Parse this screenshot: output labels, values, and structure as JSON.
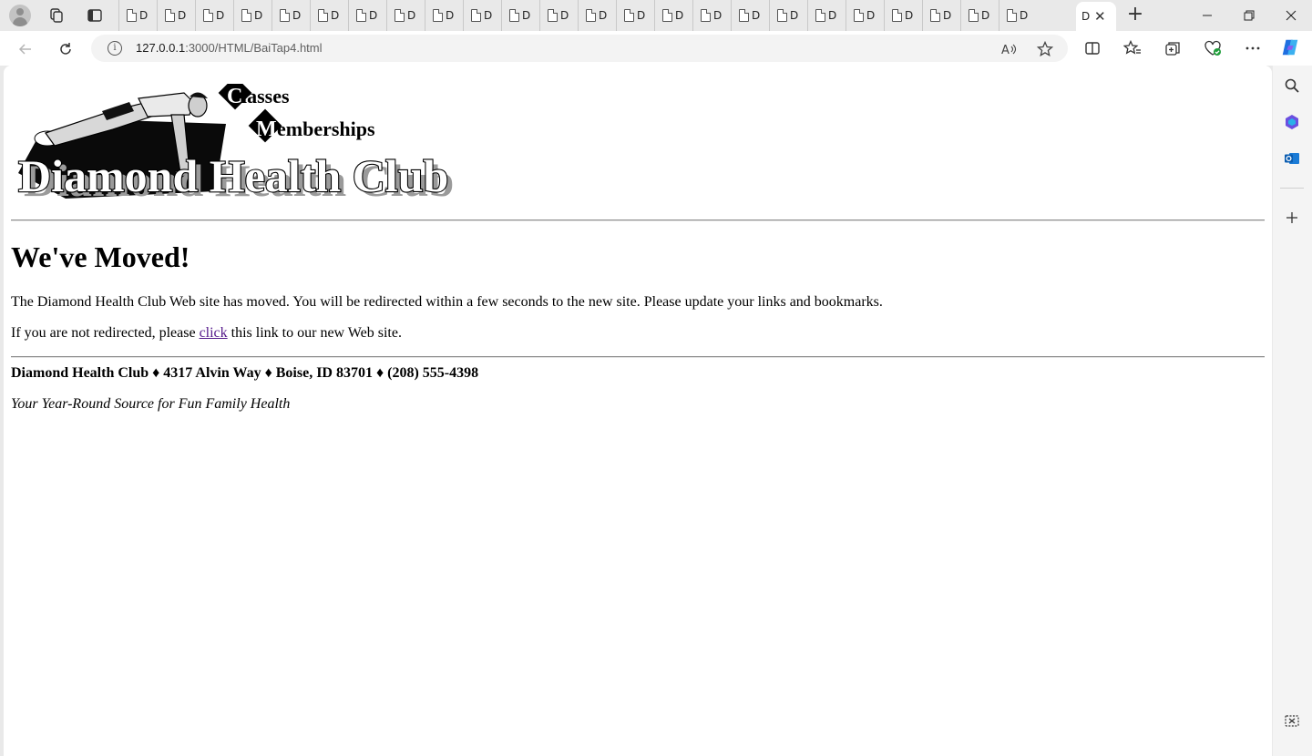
{
  "browser": {
    "tab_title_short": "D",
    "mini_tab_count": 24,
    "url_host": "127.0.0.1",
    "url_rest": ":3000/HTML/BaiTap4.html"
  },
  "banner": {
    "line1": "Classes",
    "line2": "Memberships",
    "title": "Diamond Health Club"
  },
  "page": {
    "heading": "We've Moved!",
    "paragraph1": "The Diamond Health Club Web site has moved. You will be redirected within a few seconds to the new site. Please update your links and bookmarks.",
    "p2_before": "If you are not redirected, please ",
    "p2_link": "click",
    "p2_after": " this link to our new Web site.",
    "address": "Diamond Health Club ♦ 4317 Alvin Way ♦ Boise, ID 83701 ♦ (208) 555-4398",
    "tagline": "Your Year-Round Source for Fun Family Health"
  },
  "colors": {
    "link_visited": "#551a8b",
    "chrome_bg": "#e9e9e9",
    "copilot_blue": "#1f6fe0"
  }
}
